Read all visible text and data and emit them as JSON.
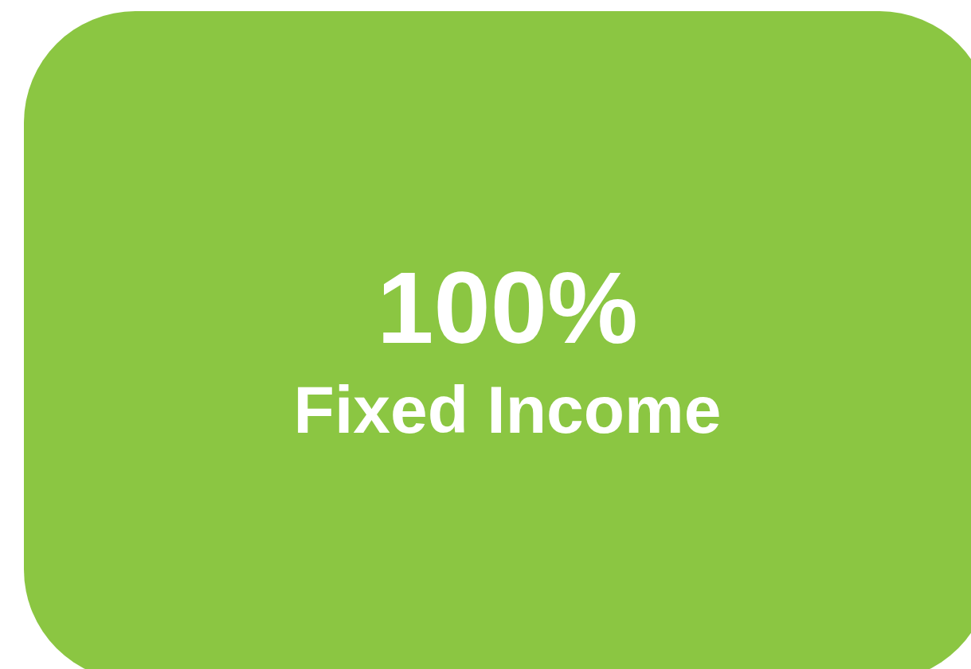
{
  "tile": {
    "value": "100%",
    "label": "Fixed Income"
  }
}
